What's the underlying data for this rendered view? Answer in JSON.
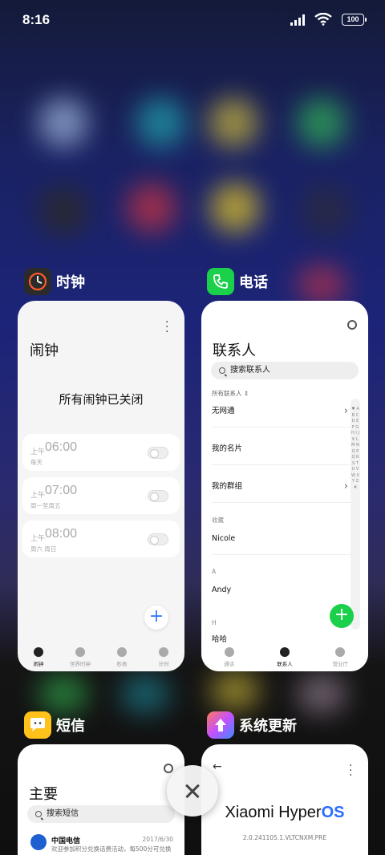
{
  "status": {
    "time": "8:16",
    "battery": "100"
  },
  "apps": {
    "clock": {
      "name": "时钟",
      "title": "闹钟",
      "empty_text": "所有闹钟已关闭",
      "alarms": [
        {
          "period": "上午",
          "time": "06:00",
          "repeat": "每天"
        },
        {
          "period": "上午",
          "time": "07:00",
          "repeat": "周一至周五"
        },
        {
          "period": "上午",
          "time": "08:00",
          "repeat": "周六 周日"
        }
      ],
      "nav": [
        "闹钟",
        "世界时钟",
        "秒表",
        "计时"
      ]
    },
    "phone": {
      "name": "电话",
      "title": "联系人",
      "search_placeholder": "搜索联系人",
      "all_contacts": "所有联系人 ⇕",
      "rows": [
        "无网通",
        "我的名片",
        "我的群组"
      ],
      "section_favorites": "收藏",
      "favorite": "Nicole",
      "section_a": "A",
      "contact_a": "Andy",
      "section_h": "H",
      "contact_h": "哈哈",
      "az": "♥ A B C D E F G H I J K L M N O P Q R S T U V W X Y Z #",
      "nav": [
        "通话",
        "联系人",
        "营业厅"
      ]
    },
    "sms": {
      "name": "短信",
      "title": "主要",
      "search_placeholder": "搜索短信",
      "message": {
        "sender": "中国电信",
        "date": "2017/6/30",
        "preview": "欢迎参加积分兑换话费活动，每500分可兑换"
      }
    },
    "update": {
      "name": "系统更新",
      "brand_prefix": "Xiaomi Hyper",
      "brand_suffix": "OS",
      "version": "2.0.241105.1.VLTCNXM.PRE"
    }
  },
  "colors": {
    "phone_green": "#1bd04a",
    "accent_blue": "#3a7bff"
  }
}
